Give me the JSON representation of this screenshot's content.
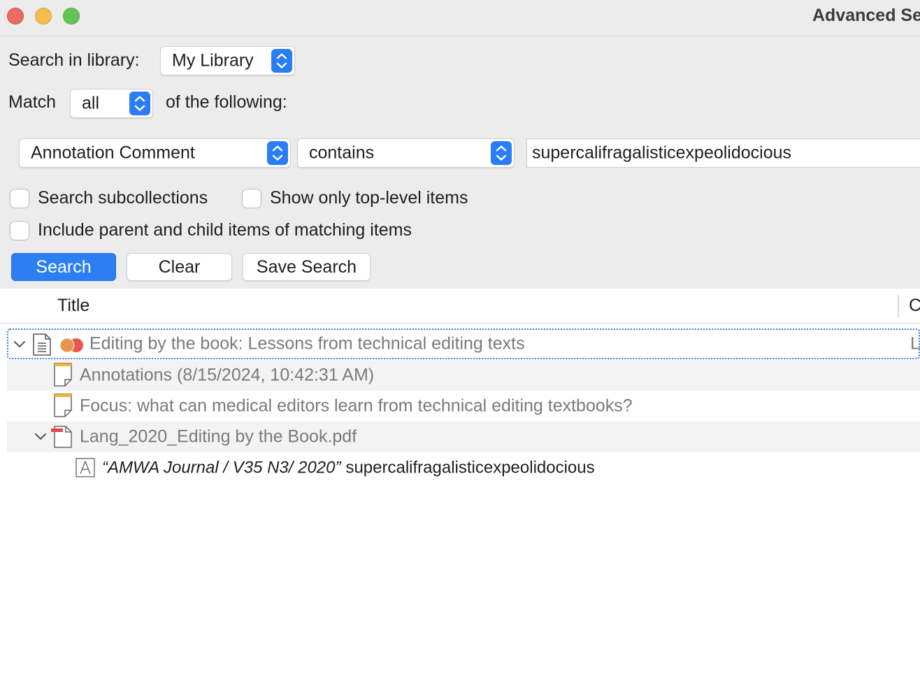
{
  "window": {
    "title": "Advanced Se"
  },
  "search": {
    "library_label": "Search in library:",
    "library_value": "My Library",
    "match_label": "Match",
    "match_value": "all",
    "following_label": "of the following:",
    "condition": {
      "field": "Annotation Comment",
      "operator": "contains",
      "value": "supercalifragalisticexpeolidocious"
    },
    "options": {
      "search_subcollections": "Search subcollections",
      "show_top_level": "Show only top-level items",
      "include_parent_child": "Include parent and child items of matching items"
    },
    "buttons": {
      "search": "Search",
      "clear": "Clear",
      "save_search": "Save Search"
    }
  },
  "results": {
    "columns": {
      "title": "Title",
      "next_column_partial": "C"
    },
    "rows": [
      {
        "title": "Editing by the book: Lessons from technical editing texts",
        "extra": "L"
      },
      {
        "title": "Annotations (8/15/2024, 10:42:31 AM)"
      },
      {
        "title": "Focus: what can medical editors learn from technical editing textbooks?"
      },
      {
        "title": "Lang_2020_Editing by the Book.pdf"
      },
      {
        "quote": "“AMWA Journal / V35 N3/ 2020”",
        "comment": "supercalifragalisticexpeolidocious"
      }
    ]
  },
  "icons": {
    "close": "close-icon",
    "minimize": "minimize-icon",
    "zoom": "zoom-icon",
    "stepper": "chevron-up-down-icon",
    "disclosure": "chevron-down-icon",
    "document": "document-icon",
    "tags": "colored-tags-icon",
    "note": "note-icon",
    "pdf": "pdf-attachment-icon",
    "text_annotation": "text-annotation-icon"
  },
  "colors": {
    "accent": "#2b7ff2",
    "close": "#ed6a5e",
    "minimize": "#f5bf4f",
    "zoom": "#61c554",
    "tag_orange": "#e8944a",
    "tag_red": "#e8574d",
    "note_yellow": "#f3b634",
    "pdf_red": "#e2464a"
  }
}
